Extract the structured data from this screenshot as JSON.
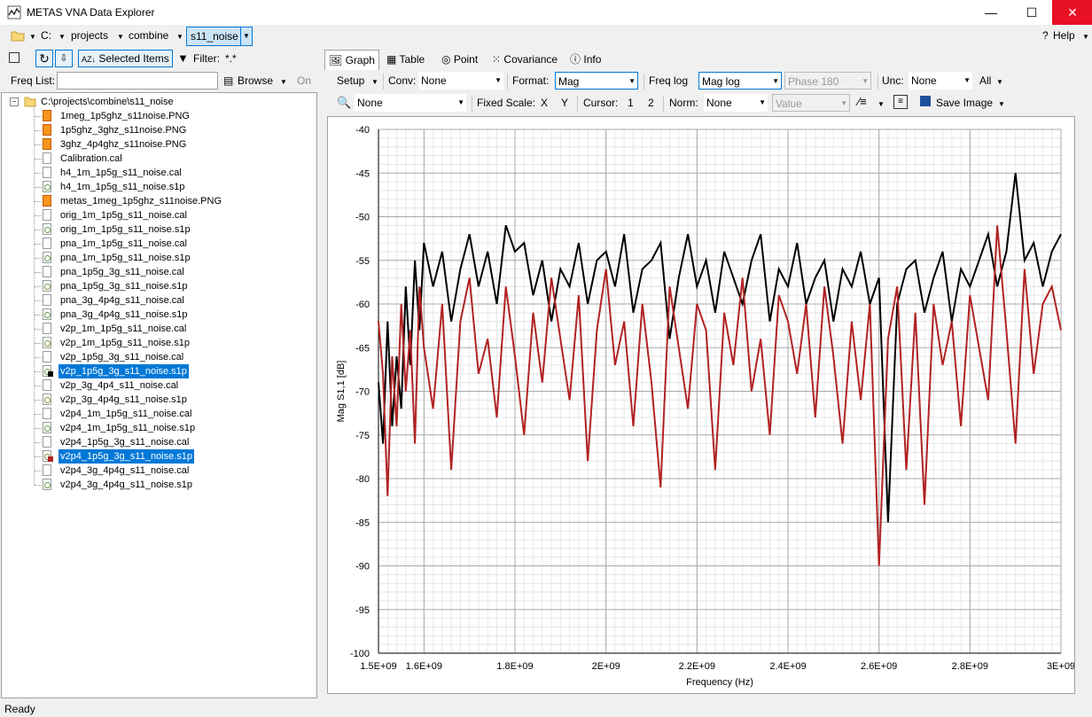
{
  "window": {
    "title": "METAS VNA Data Explorer",
    "minimize": "—",
    "maximize": "☐",
    "close": "✕"
  },
  "pathbar": {
    "drive": "C:",
    "seg1": "projects",
    "seg2": "combine",
    "seg3": "s11_noise",
    "help": "Help"
  },
  "lefttoolbar": {
    "selected_items": "Selected Items",
    "filter_label": "Filter:",
    "filter_value": "*.*"
  },
  "freqlist": {
    "label": "Freq List:",
    "value": "",
    "browse": "Browse",
    "on": "On"
  },
  "tree": {
    "root": "C:\\projects\\combine\\s11_noise",
    "items": [
      {
        "name": "1meg_1p5ghz_s11noise.PNG",
        "type": "png",
        "selected": false
      },
      {
        "name": "1p5ghz_3ghz_s11noise.PNG",
        "type": "png",
        "selected": false
      },
      {
        "name": "3ghz_4p4ghz_s11noise.PNG",
        "type": "png",
        "selected": false
      },
      {
        "name": "Calibration.cal",
        "type": "cal",
        "selected": false
      },
      {
        "name": "h4_1m_1p5g_s11_noise.cal",
        "type": "cal",
        "selected": false
      },
      {
        "name": "h4_1m_1p5g_s11_noise.s1p",
        "type": "s1p",
        "selected": false
      },
      {
        "name": "metas_1meg_1p5ghz_s11noise.PNG",
        "type": "png",
        "selected": false
      },
      {
        "name": "orig_1m_1p5g_s11_noise.cal",
        "type": "cal",
        "selected": false
      },
      {
        "name": "orig_1m_1p5g_s11_noise.s1p",
        "type": "s1p",
        "selected": false
      },
      {
        "name": "pna_1m_1p5g_s11_noise.cal",
        "type": "cal",
        "selected": false
      },
      {
        "name": "pna_1m_1p5g_s11_noise.s1p",
        "type": "s1p",
        "selected": false
      },
      {
        "name": "pna_1p5g_3g_s11_noise.cal",
        "type": "cal",
        "selected": false
      },
      {
        "name": "pna_1p5g_3g_s11_noise.s1p",
        "type": "s1p",
        "selected": false
      },
      {
        "name": "pna_3g_4p4g_s11_noise.cal",
        "type": "cal",
        "selected": false
      },
      {
        "name": "pna_3g_4p4g_s11_noise.s1p",
        "type": "s1p",
        "selected": false
      },
      {
        "name": "v2p_1m_1p5g_s11_noise.cal",
        "type": "cal",
        "selected": false
      },
      {
        "name": "v2p_1m_1p5g_s11_noise.s1p",
        "type": "s1p",
        "selected": false
      },
      {
        "name": "v2p_1p5g_3g_s11_noise.cal",
        "type": "cal",
        "selected": false
      },
      {
        "name": "v2p_1p5g_3g_s11_noise.s1p",
        "type": "s1p",
        "selected": true,
        "marker": "#000000"
      },
      {
        "name": "v2p_3g_4p4_s11_noise.cal",
        "type": "cal",
        "selected": false
      },
      {
        "name": "v2p_3g_4p4g_s11_noise.s1p",
        "type": "s1p",
        "selected": false
      },
      {
        "name": "v2p4_1m_1p5g_s11_noise.cal",
        "type": "cal",
        "selected": false
      },
      {
        "name": "v2p4_1m_1p5g_s11_noise.s1p",
        "type": "s1p",
        "selected": false
      },
      {
        "name": "v2p4_1p5g_3g_s11_noise.cal",
        "type": "cal",
        "selected": false
      },
      {
        "name": "v2p4_1p5g_3g_s11_noise.s1p",
        "type": "s1p",
        "selected": true,
        "marker": "#b22222"
      },
      {
        "name": "v2p4_3g_4p4g_s11_noise.cal",
        "type": "cal",
        "selected": false
      },
      {
        "name": "v2p4_3g_4p4g_s11_noise.s1p",
        "type": "s1p",
        "selected": false
      }
    ]
  },
  "tabs": [
    "Graph",
    "Table",
    "Point",
    "Covariance",
    "Info"
  ],
  "toolbar1": {
    "setup": "Setup",
    "conv_label": "Conv:",
    "conv_value": "None",
    "format_label": "Format:",
    "format_value": "Mag",
    "freqlog": "Freq log",
    "maglog": "Mag log",
    "phase": "Phase 180",
    "unc_label": "Unc:",
    "unc_value": "None",
    "all": "All"
  },
  "toolbar2": {
    "zoom_value": "None",
    "fixed_scale": "Fixed Scale:",
    "x": "X",
    "y": "Y",
    "cursor": "Cursor:",
    "c1": "1",
    "c2": "2",
    "norm_label": "Norm:",
    "norm_value": "None",
    "value_placeholder": "Value",
    "save_image": "Save Image"
  },
  "status": {
    "text": "Ready"
  },
  "chart_data": {
    "type": "line",
    "xlabel": "Frequency (Hz)",
    "ylabel": "Mag S1,1 [dB]",
    "xlim": [
      1500000000.0,
      3000000000.0
    ],
    "ylim": [
      -100,
      -40
    ],
    "xticks": [
      1500000000.0,
      1600000000.0,
      1800000000.0,
      2000000000.0,
      2200000000.0,
      2400000000.0,
      2600000000.0,
      2800000000.0,
      3000000000.0
    ],
    "xtick_labels": [
      "1.5E+09",
      "1.6E+09",
      "1.8E+09",
      "2E+09",
      "2.2E+09",
      "2.4E+09",
      "2.6E+09",
      "2.8E+09",
      "3E+09"
    ],
    "yticks": [
      -40,
      -45,
      -50,
      -55,
      -60,
      -65,
      -70,
      -75,
      -80,
      -85,
      -90,
      -95,
      -100
    ],
    "grid": true,
    "series": [
      {
        "color": "#000000",
        "x": [
          1500000000.0,
          1510000000.0,
          1520000000.0,
          1530000000.0,
          1540000000.0,
          1550000000.0,
          1560000000.0,
          1570000000.0,
          1580000000.0,
          1590000000.0,
          1600000000.0,
          1620000000.0,
          1640000000.0,
          1660000000.0,
          1680000000.0,
          1700000000.0,
          1720000000.0,
          1740000000.0,
          1760000000.0,
          1780000000.0,
          1800000000.0,
          1820000000.0,
          1840000000.0,
          1860000000.0,
          1880000000.0,
          1900000000.0,
          1920000000.0,
          1940000000.0,
          1960000000.0,
          1980000000.0,
          2000000000.0,
          2020000000.0,
          2040000000.0,
          2060000000.0,
          2080000000.0,
          2100000000.0,
          2120000000.0,
          2140000000.0,
          2160000000.0,
          2180000000.0,
          2200000000.0,
          2220000000.0,
          2240000000.0,
          2260000000.0,
          2280000000.0,
          2300000000.0,
          2320000000.0,
          2340000000.0,
          2360000000.0,
          2380000000.0,
          2400000000.0,
          2420000000.0,
          2440000000.0,
          2460000000.0,
          2480000000.0,
          2500000000.0,
          2520000000.0,
          2540000000.0,
          2560000000.0,
          2580000000.0,
          2600000000.0,
          2620000000.0,
          2640000000.0,
          2660000000.0,
          2680000000.0,
          2700000000.0,
          2720000000.0,
          2740000000.0,
          2760000000.0,
          2780000000.0,
          2800000000.0,
          2820000000.0,
          2840000000.0,
          2860000000.0,
          2880000000.0,
          2900000000.0,
          2920000000.0,
          2940000000.0,
          2960000000.0,
          2980000000.0,
          3000000000.0
        ],
        "y": [
          -69,
          -76,
          -62,
          -74,
          -66,
          -72,
          -58,
          -67,
          -55,
          -63,
          -53,
          -58,
          -54,
          -62,
          -56,
          -52,
          -58,
          -54,
          -60,
          -51,
          -54,
          -53,
          -59,
          -55,
          -62,
          -56,
          -58,
          -53,
          -60,
          -55,
          -54,
          -58,
          -52,
          -61,
          -56,
          -55,
          -53,
          -64,
          -57,
          -52,
          -58,
          -55,
          -61,
          -54,
          -57,
          -60,
          -55,
          -52,
          -62,
          -56,
          -58,
          -53,
          -60,
          -57,
          -55,
          -62,
          -56,
          -58,
          -54,
          -60,
          -57,
          -85,
          -60,
          -56,
          -55,
          -61,
          -57,
          -54,
          -62,
          -56,
          -58,
          -55,
          -52,
          -58,
          -54,
          -45,
          -55,
          -53,
          -58,
          -54,
          -52
        ]
      },
      {
        "color": "#b22222",
        "x": [
          1500000000.0,
          1510000000.0,
          1520000000.0,
          1530000000.0,
          1540000000.0,
          1550000000.0,
          1560000000.0,
          1570000000.0,
          1580000000.0,
          1590000000.0,
          1600000000.0,
          1620000000.0,
          1640000000.0,
          1660000000.0,
          1680000000.0,
          1700000000.0,
          1720000000.0,
          1740000000.0,
          1760000000.0,
          1780000000.0,
          1800000000.0,
          1820000000.0,
          1840000000.0,
          1860000000.0,
          1880000000.0,
          1900000000.0,
          1920000000.0,
          1940000000.0,
          1960000000.0,
          1980000000.0,
          2000000000.0,
          2020000000.0,
          2040000000.0,
          2060000000.0,
          2080000000.0,
          2100000000.0,
          2120000000.0,
          2140000000.0,
          2160000000.0,
          2180000000.0,
          2200000000.0,
          2220000000.0,
          2240000000.0,
          2260000000.0,
          2280000000.0,
          2300000000.0,
          2320000000.0,
          2340000000.0,
          2360000000.0,
          2380000000.0,
          2400000000.0,
          2420000000.0,
          2440000000.0,
          2460000000.0,
          2480000000.0,
          2500000000.0,
          2520000000.0,
          2540000000.0,
          2560000000.0,
          2580000000.0,
          2600000000.0,
          2620000000.0,
          2640000000.0,
          2660000000.0,
          2680000000.0,
          2700000000.0,
          2720000000.0,
          2740000000.0,
          2760000000.0,
          2780000000.0,
          2800000000.0,
          2820000000.0,
          2840000000.0,
          2860000000.0,
          2880000000.0,
          2900000000.0,
          2920000000.0,
          2940000000.0,
          2960000000.0,
          2980000000.0,
          3000000000.0
        ],
        "y": [
          -62,
          -68,
          -82,
          -66,
          -74,
          -60,
          -70,
          -63,
          -76,
          -58,
          -65,
          -72,
          -60,
          -79,
          -62,
          -57,
          -68,
          -64,
          -73,
          -58,
          -66,
          -75,
          -61,
          -69,
          -57,
          -64,
          -71,
          -59,
          -78,
          -63,
          -56,
          -67,
          -62,
          -74,
          -60,
          -69,
          -81,
          -58,
          -65,
          -72,
          -60,
          -63,
          -79,
          -61,
          -67,
          -57,
          -70,
          -64,
          -75,
          -59,
          -62,
          -68,
          -60,
          -73,
          -58,
          -66,
          -76,
          -62,
          -71,
          -60,
          -90,
          -64,
          -58,
          -79,
          -61,
          -83,
          -60,
          -67,
          -62,
          -74,
          -59,
          -65,
          -71,
          -51,
          -63,
          -76,
          -56,
          -68,
          -60,
          -58,
          -63
        ]
      }
    ]
  }
}
